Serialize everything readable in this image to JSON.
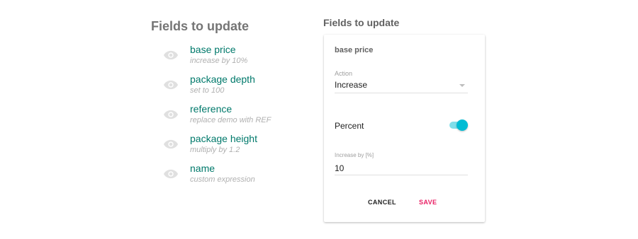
{
  "left_panel": {
    "title": "Fields to update",
    "fields": [
      {
        "name": "base price",
        "description": "increase by 10%",
        "icon": "eye-icon"
      },
      {
        "name": "package depth",
        "description": "set to 100",
        "icon": "eye-icon"
      },
      {
        "name": "reference",
        "description": "replace demo with REF",
        "icon": "eye-icon"
      },
      {
        "name": "package height",
        "description": "multiply by 1.2",
        "icon": "eye-icon"
      },
      {
        "name": "name",
        "description": "custom expression",
        "icon": "eye-icon"
      }
    ]
  },
  "right_panel": {
    "title": "Fields to update",
    "card": {
      "title": "base price",
      "action_label": "Action",
      "action_value": "Increase",
      "percent_label": "Percent",
      "percent_enabled": true,
      "increase_label": "Increase by [%]",
      "increase_value": "10",
      "cancel_label": "CANCEL",
      "save_label": "SAVE"
    }
  },
  "colors": {
    "field_name": "#00796b",
    "field_desc": "#b0b0b0",
    "toggle_on": "#00bcd4",
    "save_accent": "#e91e63"
  }
}
